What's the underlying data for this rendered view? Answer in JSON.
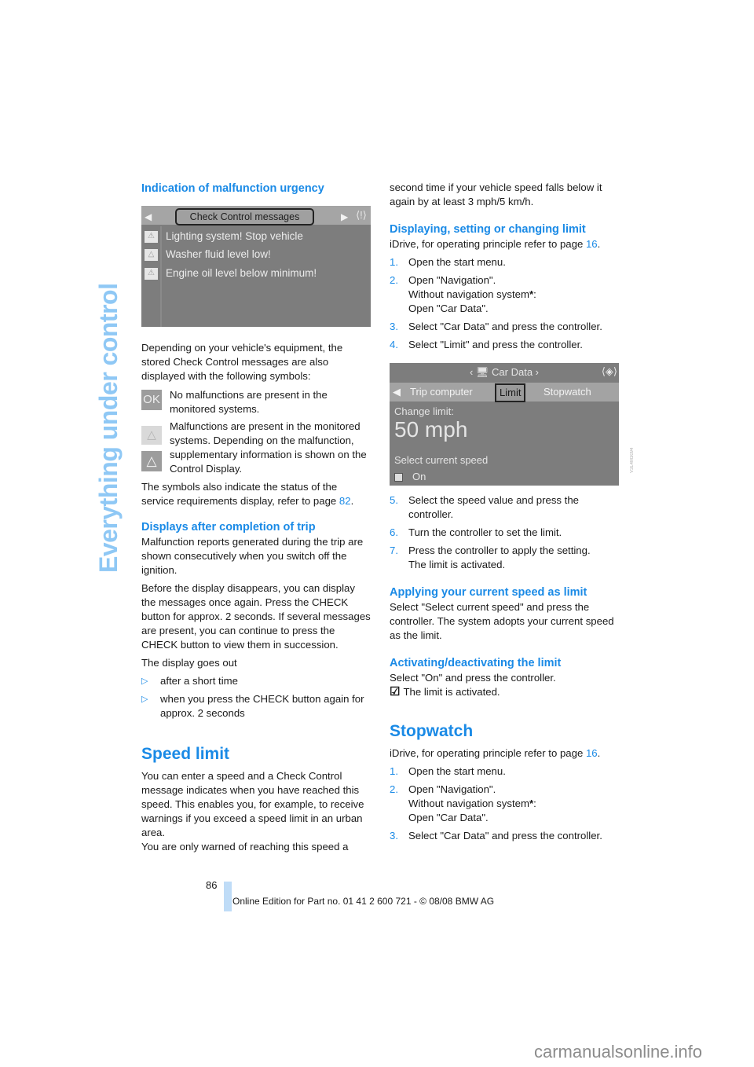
{
  "section_tab": "Everything under control",
  "left": {
    "h_malfunction": "Indication of malfunction urgency",
    "screen1": {
      "header_tab": "Check Control messages",
      "left_arrow_icon": "◀",
      "right_arrow_icon": "▶",
      "controller_icon": "⟨!⟩",
      "messages": [
        {
          "icon": "warning-triangle",
          "text": "Lighting system! Stop vehicle"
        },
        {
          "icon": "warning-triangle-small",
          "text": "Washer fluid level low!"
        },
        {
          "icon": "warning-triangle",
          "text": "Engine oil level below minimum!"
        }
      ]
    },
    "p_equipment": "Depending on your vehicle's equipment, the stored Check Control messages are also displayed with the following symbols:",
    "symbols": {
      "ok_label": "OK",
      "ok_text": "No malfunctions are present in the monitored systems.",
      "tri_text": "Malfunctions are present in the monitored systems. Depending on the malfunction, supplementary information is shown on the Control Display."
    },
    "p_status_pre": "The symbols also indicate the status of the service requirements display, refer to page ",
    "p_status_link": "82",
    "p_status_post": ".",
    "h_trip": "Displays after completion of trip",
    "p_trip1": "Malfunction reports generated during the trip are shown consecutively when you switch off the ignition.",
    "p_trip2": "Before the display disappears, you can display the messages once again. Press the CHECK button for approx. 2 seconds. If several messages are present, you can continue to press the CHECK button to view them in succession.",
    "p_goes_out": "The display goes out",
    "bullets": [
      "after a short time",
      "when you press the CHECK button again for approx. 2 seconds"
    ],
    "bullet_glyph": "▷",
    "h_speed_limit": "Speed limit",
    "p_speed1": "You can enter a speed and a Check Control message indicates when you have reached this speed. This enables you, for example, to receive warnings if you exceed a speed limit in an urban area.",
    "p_speed2": "You are only warned of reaching this speed a"
  },
  "right": {
    "p_cont": "second time if your vehicle speed falls below it again by at least 3 mph/5 km/h.",
    "h_display": "Displaying, setting or changing limit",
    "p_idrive_pre": "iDrive, for operating principle refer to page ",
    "p_idrive_link": "16",
    "p_idrive_post": ".",
    "steps_a": [
      {
        "n": "1.",
        "t": "Open the start menu."
      },
      {
        "n": "2.",
        "t": "Open \"Navigation\".",
        "t2": "Without navigation system",
        "t2_star": "*",
        "t2_post": ":",
        "t3": "Open \"Car Data\"."
      },
      {
        "n": "3.",
        "t": "Select \"Car Data\" and press the controller."
      },
      {
        "n": "4.",
        "t": "Select \"Limit\" and press the controller."
      }
    ],
    "screen2": {
      "title": "‹ 🖥 Car Data ›",
      "controller_icon": "⟨◈⟩",
      "tab_arrow": "◀",
      "tabs": [
        "Trip computer",
        "Limit",
        "Stopwatch"
      ],
      "active_tab": "Limit",
      "change_label": "Change limit:",
      "value": "50 mph",
      "select_current": "Select current speed",
      "on_label": "On",
      "code": "V3L4M3094"
    },
    "steps_b": [
      {
        "n": "5.",
        "t": "Select the speed value and press the controller."
      },
      {
        "n": "6.",
        "t": "Turn the controller to set the limit."
      },
      {
        "n": "7.",
        "t": "Press the controller to apply the setting.",
        "t2": "The limit is activated."
      }
    ],
    "h_apply": "Applying your current speed as limit",
    "p_apply": "Select \"Select current speed\" and press the controller. The system adopts your current speed as the limit.",
    "h_activate": "Activating/deactivating the limit",
    "p_activate": "Select \"On\" and press the controller.",
    "p_activated": "The limit is activated.",
    "h_stopwatch": "Stopwatch",
    "steps_c": [
      {
        "n": "1.",
        "t": "Open the start menu."
      },
      {
        "n": "2.",
        "t": "Open \"Navigation\".",
        "t2": "Without navigation system",
        "t2_star": "*",
        "t2_post": ":",
        "t3": "Open \"Car Data\"."
      },
      {
        "n": "3.",
        "t": "Select \"Car Data\" and press the controller."
      }
    ]
  },
  "footer": {
    "page_number": "86",
    "edition": "Online Edition for Part no. 01 41 2 600 721 - © 08/08 BMW AG",
    "watermark": "carmanualsonline.info"
  }
}
